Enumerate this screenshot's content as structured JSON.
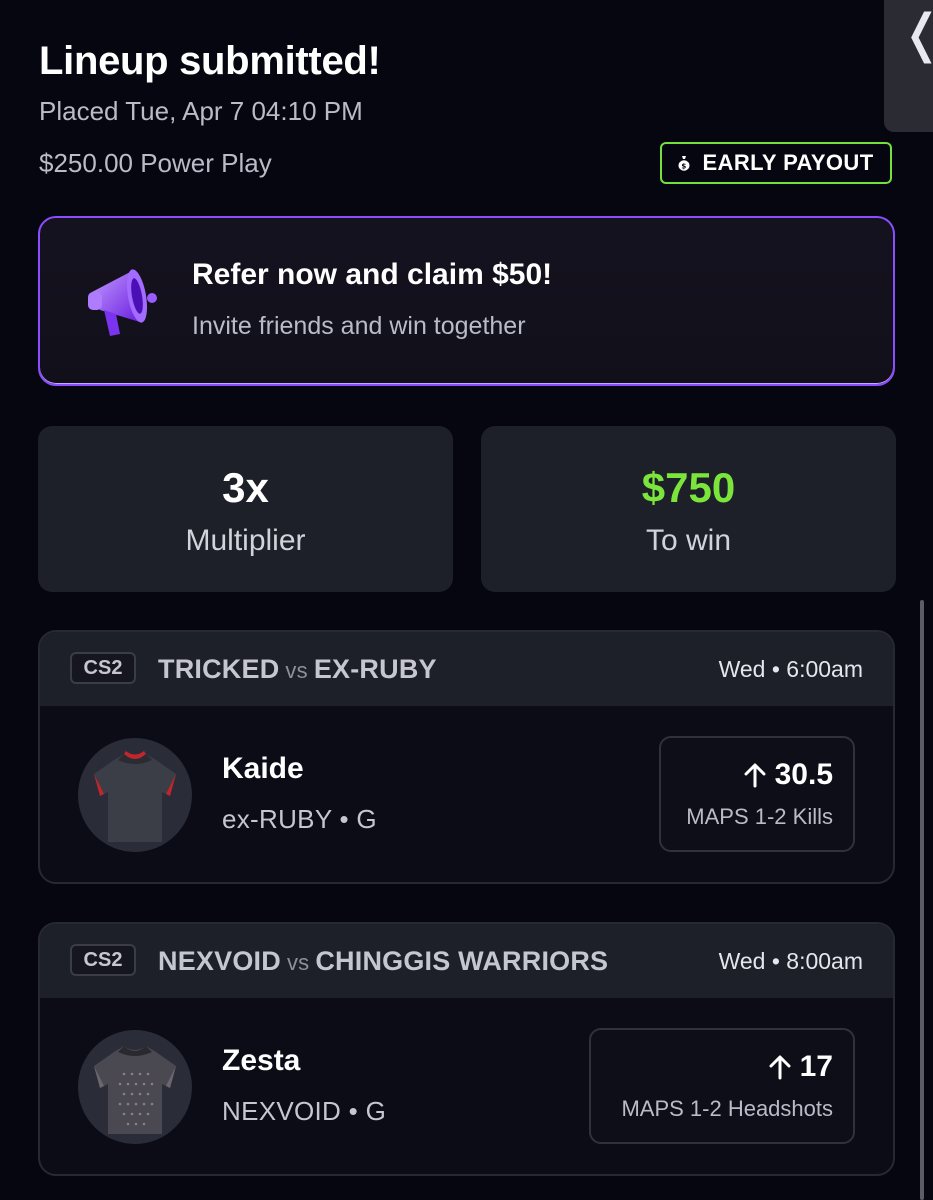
{
  "header": {
    "title": "Lineup submitted!",
    "placed": "Placed Tue, Apr 7 04:10 PM",
    "play_type": "$250.00 Power Play",
    "badge": "EARLY PAYOUT"
  },
  "referral": {
    "title": "Refer now and claim $50!",
    "subtitle": "Invite friends and win together",
    "icon": "megaphone-icon"
  },
  "stats": {
    "multiplier_value": "3x",
    "multiplier_label": "Multiplier",
    "win_value": "$750",
    "win_label": "To win"
  },
  "picks": [
    {
      "game": "CS2",
      "team1": "TRICKED",
      "vs": "vs",
      "team2": "EX-RUBY",
      "time": "Wed • 6:00am",
      "player": "Kaide",
      "team_pos": "ex-RUBY • G",
      "line": "30.5",
      "stat": "MAPS 1-2 Kills",
      "direction": "up"
    },
    {
      "game": "CS2",
      "team1": "NEXVOID",
      "vs": "vs",
      "team2": "CHINGGIS WARRIORS",
      "time": "Wed • 8:00am",
      "player": "Zesta",
      "team_pos": "NEXVOID • G",
      "line": "17",
      "stat": "MAPS 1-2 Headshots",
      "direction": "up"
    }
  ],
  "colors": {
    "accent_green": "#7be53b",
    "accent_purple": "#8b4dff",
    "background": "#05060f",
    "card": "#1d1f29"
  }
}
